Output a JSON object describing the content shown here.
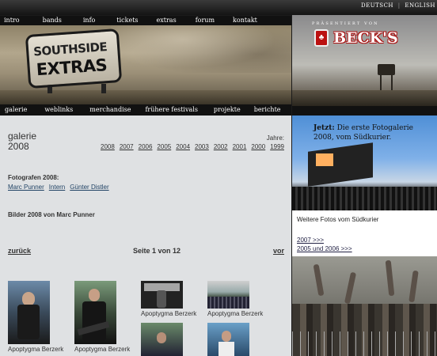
{
  "topbar": {
    "lang_de": "DEUTSCH",
    "separator": "|",
    "lang_en": "ENGLISH"
  },
  "nav_top": [
    "intro",
    "bands",
    "info",
    "tickets",
    "extras",
    "forum",
    "kontakt"
  ],
  "header": {
    "sign_line1": "SOUTHSIDE",
    "sign_line2": "EXTRAS"
  },
  "nav_sub": [
    "galerie",
    "weblinks",
    "merchandise",
    "frühere festivals",
    "projekte",
    "berichte"
  ],
  "main": {
    "title_line1": "galerie",
    "title_line2": "2008",
    "years_label": "Jahre:",
    "years": [
      "2008",
      "2007",
      "2006",
      "2005",
      "2004",
      "2003",
      "2002",
      "2001",
      "2000",
      "1999"
    ],
    "photographers_label": "Fotografen 2008:",
    "photographers": [
      "Marc Punner",
      "Intern",
      "Günter Distler"
    ],
    "pictures_heading": "Bilder 2008 von Marc Punner",
    "back_link": "zurück",
    "page_indicator": "Seite 1 von 12",
    "next_link": "vor",
    "thumbnails": [
      {
        "caption": "Apoptygma Berzerk"
      },
      {
        "caption": "Apoptygma Berzerk"
      },
      {
        "caption": "Apoptygma Berzerk"
      },
      {
        "caption": "Apoptygma Berzerk"
      }
    ]
  },
  "sidebar": {
    "presented_by": "PRÄSENTIERT VON",
    "sponsor_name": "BECK'S",
    "promo_bold": "Jetzt:",
    "promo_text": " Die erste Fotogalerie 2008, vom Südkurier.",
    "more_photos": "Weitere Fotos vom Südkurier",
    "link_2007": "2007 >>>",
    "link_2005": "2005 und 2006 >>>"
  },
  "colors": {
    "nav_bg": "#111111",
    "main_bg": "#dfe1e3",
    "accent_red": "#b11111"
  }
}
